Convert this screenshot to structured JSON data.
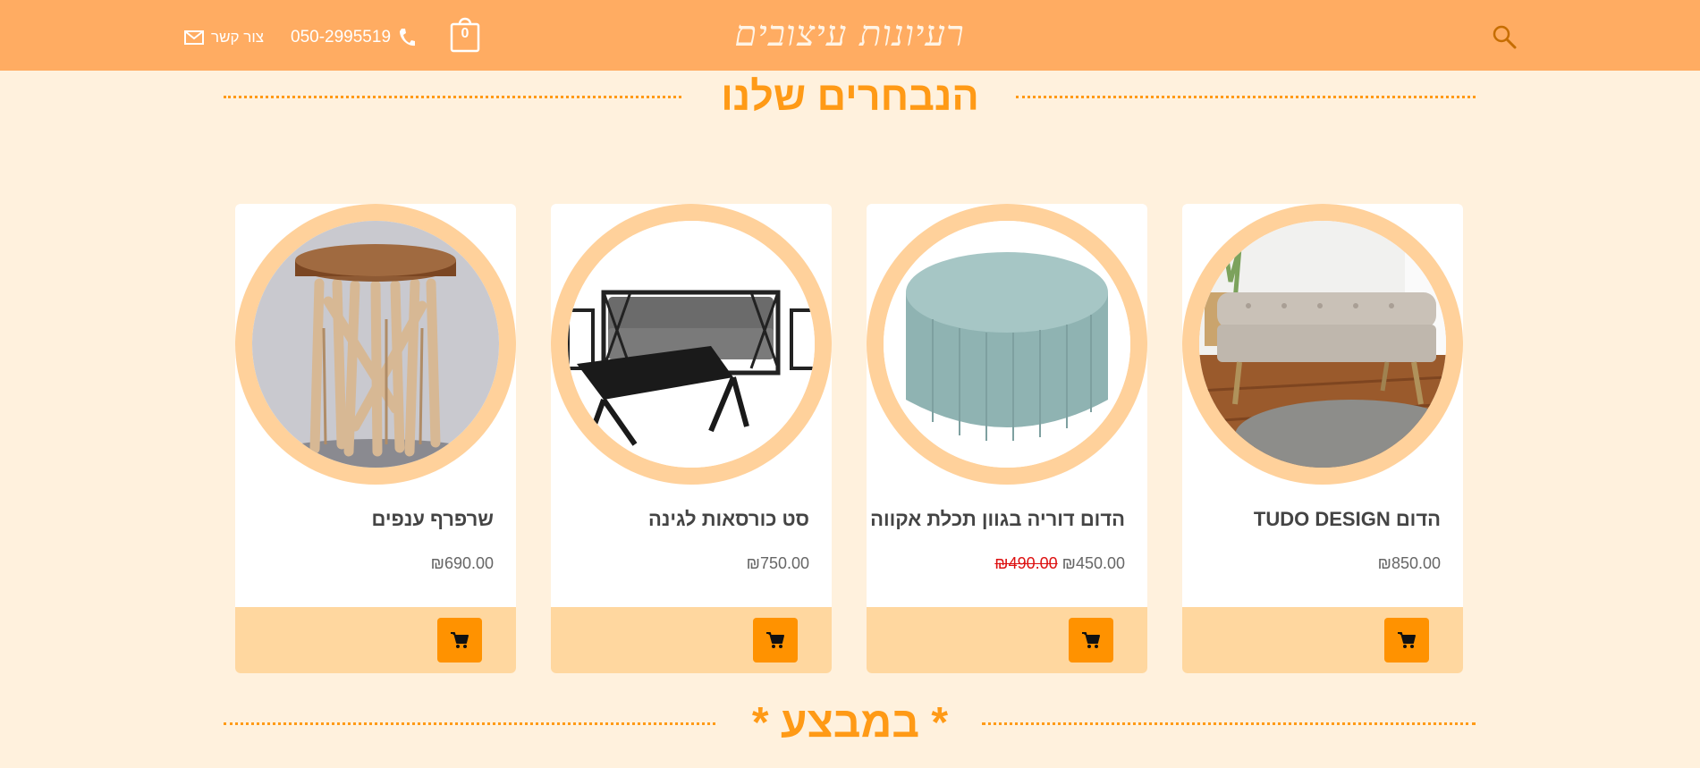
{
  "header": {
    "logo": "רעיונות עיצובים",
    "contact_label": "צור קשר",
    "phone": "050-2995519",
    "cart_count": "0",
    "colors": {
      "bar": "#ffac62",
      "accent": "#ff9a16"
    }
  },
  "sections": {
    "featured_title": "הנבחרים שלנו",
    "sale_title": "* במבצע *"
  },
  "products": [
    {
      "name": "הדום TUDO DESIGN",
      "price": "₪850.00",
      "old_price": "",
      "image": "upholstered bench in bedroom",
      "cart_icon": "cart-icon"
    },
    {
      "name": "הדום דוריה בגוון תכלת אקווה",
      "price": "₪450.00",
      "old_price": "₪490.00",
      "image": "round aqua velvet pouf",
      "cart_icon": "cart-icon"
    },
    {
      "name": "סט כורסאות לגינה",
      "price": "₪750.00",
      "old_price": "",
      "image": "garden sofa set with table",
      "cart_icon": "cart-icon"
    },
    {
      "name": "שרפרף ענפים",
      "price": "₪690.00",
      "old_price": "",
      "image": "branch stool with wood top",
      "cart_icon": "cart-icon"
    }
  ]
}
